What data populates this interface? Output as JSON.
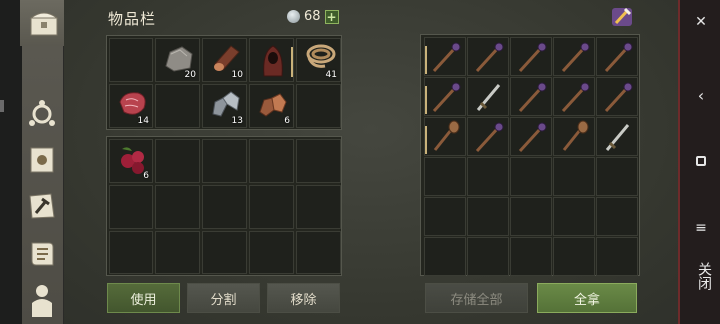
{
  "inventory": {
    "title": "物品栏",
    "currency_value": "68",
    "add_label": "+",
    "slots": [
      {
        "icon": "stone-icon",
        "count": "20"
      },
      {
        "icon": "wood-log-icon",
        "count": "10"
      },
      {
        "icon": "hood-cloak-icon",
        "count": ""
      },
      {
        "icon": "rope-icon",
        "count": "41"
      },
      {
        "icon": "raw-meat-icon",
        "count": "14"
      },
      {
        "icon": "iron-ore-icon",
        "count": "13"
      },
      {
        "icon": "copper-ore-icon",
        "count": "6"
      },
      {
        "icon": "berries-icon",
        "count": "6"
      }
    ],
    "buttons": {
      "use": "使用",
      "split": "分割",
      "remove": "移除"
    }
  },
  "storage": {
    "buttons": {
      "store_all": "存储全部",
      "take_all": "全拿"
    }
  },
  "nav": {
    "close_label": "关闭",
    "icons": [
      "close-x-icon",
      "back-chevron-icon",
      "home-square-icon",
      "menu-lines-icon"
    ]
  },
  "sidebar": {
    "icons": [
      "chest-icon",
      "skills-tree-icon",
      "sun-book-icon",
      "crafting-hammer-icon",
      "scroll-map-icon",
      "character-icon"
    ]
  },
  "colors": {
    "accent_green": "#6a8a47",
    "close_border": "#6e2b2b"
  }
}
